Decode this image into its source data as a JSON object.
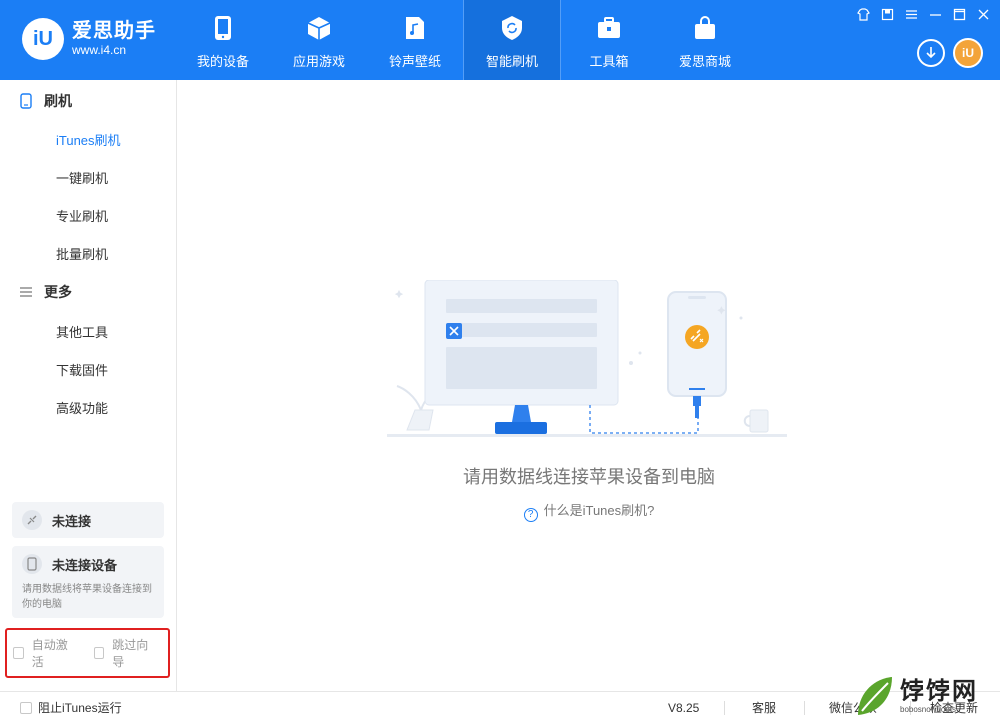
{
  "app": {
    "name": "爱思助手",
    "url": "www.i4.cn",
    "logo_mark": "iU"
  },
  "nav": [
    {
      "label": "我的设备",
      "icon": "phone-icon"
    },
    {
      "label": "应用游戏",
      "icon": "cube-icon"
    },
    {
      "label": "铃声壁纸",
      "icon": "music-file-icon"
    },
    {
      "label": "智能刷机",
      "icon": "refresh-shield-icon"
    },
    {
      "label": "工具箱",
      "icon": "toolbox-icon"
    },
    {
      "label": "爱思商城",
      "icon": "shopping-bag-icon"
    }
  ],
  "header": {
    "avatar_mark": "iU"
  },
  "sidebar": {
    "flash_title": "刷机",
    "flash_items": [
      "iTunes刷机",
      "一键刷机",
      "专业刷机",
      "批量刷机"
    ],
    "more_title": "更多",
    "more_items": [
      "其他工具",
      "下载固件",
      "高级功能"
    ],
    "status_connection": "未连接",
    "status_device": "未连接设备",
    "status_hint": "请用数据线将苹果设备连接到你的电脑",
    "opt_auto_activate": "自动激活",
    "opt_skip_guide": "跳过向导"
  },
  "main": {
    "message": "请用数据线连接苹果设备到电脑",
    "help_link": "什么是iTunes刷机?"
  },
  "footer": {
    "block_itunes": "阻止iTunes运行",
    "version": "V8.25",
    "support": "客服",
    "wechat": "微信公众",
    "check_update": "检查更新"
  },
  "watermark": {
    "text": "饽饽网",
    "sub": "bobosnowboots"
  },
  "colors": {
    "brand": "#1b7ef5",
    "highlight_box": "#e02020",
    "accent_badge": "#f5a623"
  }
}
